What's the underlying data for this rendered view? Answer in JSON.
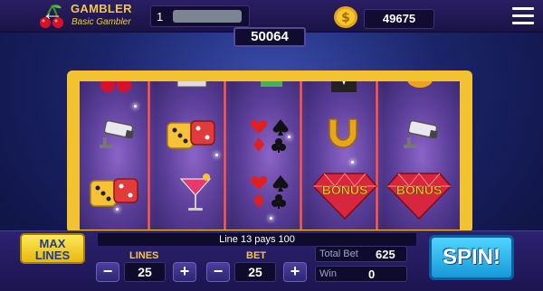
{
  "header": {
    "brand_name": "GAMBLER",
    "brand_rank": "Basic Gambler",
    "level": "1",
    "coins": "49675",
    "icons": [
      "cherry-icon",
      "back-arrow-icon",
      "coin-icon",
      "menu-icon"
    ]
  },
  "jackpot": "50064",
  "reels": {
    "columns": [
      [
        "cherries",
        "security-camera",
        "dice"
      ],
      [
        "unknown-symbol",
        "dice",
        "cocktail"
      ],
      [
        "cube",
        "card-suits",
        "card-suits"
      ],
      [
        "tuxedo",
        "horseshoe",
        "bonus-diamond"
      ],
      [
        "orange",
        "security-camera",
        "bonus-diamond"
      ]
    ],
    "bonus_label": "BONUS"
  },
  "controls": {
    "max_lines_label": "MAX LINES",
    "payline_message": "Line 13 pays 100",
    "lines_label": "LINES",
    "lines_value": "25",
    "bet_label": "BET",
    "bet_value": "25",
    "minus_label": "−",
    "plus_label": "+",
    "total_bet_label": "Total Bet",
    "total_bet_value": "625",
    "win_label": "Win",
    "win_value": "0",
    "spin_label": "SPIN!"
  },
  "colors": {
    "gold": "#f3c93c",
    "frame": "#f2c230",
    "spin": "#1799d8",
    "reel_divider": "#ff6b6b"
  }
}
